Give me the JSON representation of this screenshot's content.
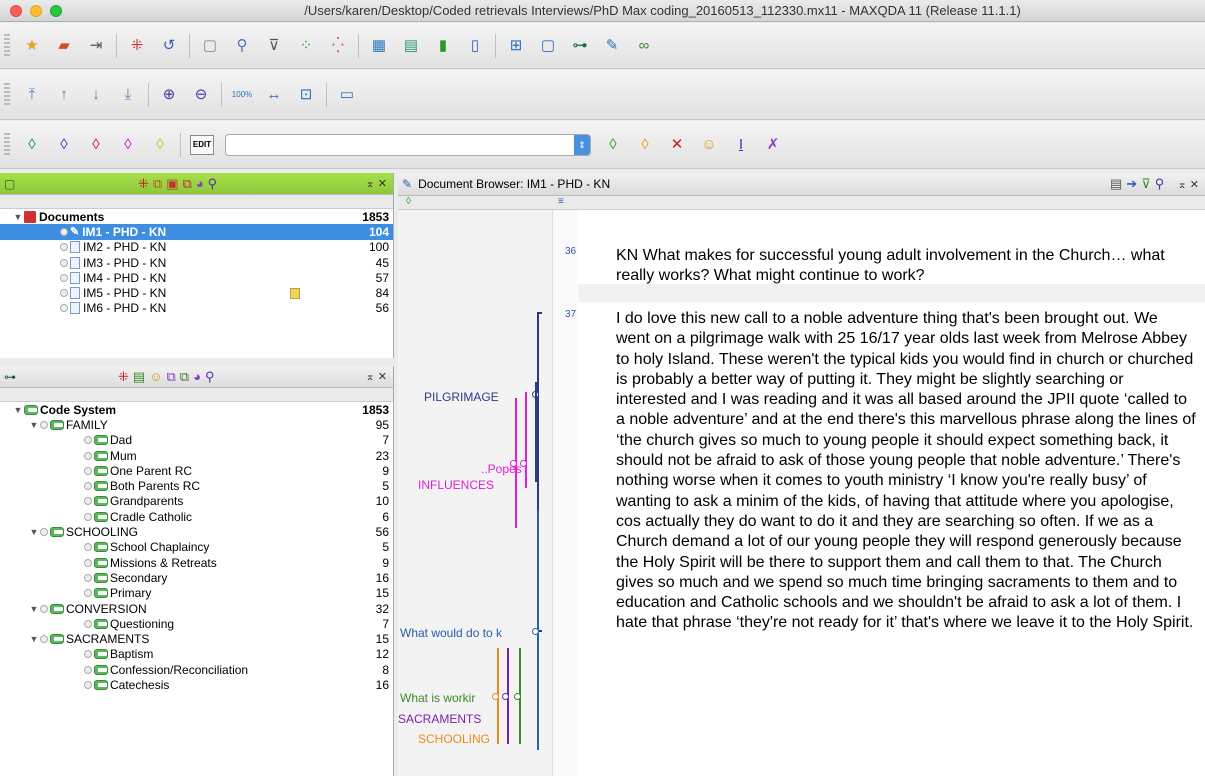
{
  "window": {
    "title": "/Users/karen/Desktop/Coded retrievals Interviews/PhD Max coding_20160513_112330.mx11 - MAXQDA 11 (Release 11.1.1)"
  },
  "toolbar3": {
    "edit_label": "EDIT"
  },
  "documents_panel": {
    "root": {
      "label": "Documents",
      "count": "1853"
    },
    "items": [
      {
        "label": "IM1 - PHD - KN",
        "count": "104"
      },
      {
        "label": "IM2 - PHD - KN",
        "count": "100"
      },
      {
        "label": "IM3 - PHD - KN",
        "count": "45"
      },
      {
        "label": "IM4 - PHD - KN",
        "count": "57"
      },
      {
        "label": "IM5 - PHD - KN",
        "count": "84"
      },
      {
        "label": "IM6 - PHD - KN",
        "count": "56"
      }
    ]
  },
  "code_panel": {
    "root": {
      "label": "Code System",
      "count": "1853"
    },
    "items": [
      {
        "label": "FAMILY",
        "count": "95"
      },
      {
        "label": "Dad",
        "count": "7"
      },
      {
        "label": "Mum",
        "count": "23"
      },
      {
        "label": "One Parent RC",
        "count": "9"
      },
      {
        "label": "Both Parents RC",
        "count": "5"
      },
      {
        "label": "Grandparents",
        "count": "10"
      },
      {
        "label": "Cradle Catholic",
        "count": "6"
      },
      {
        "label": "SCHOOLING",
        "count": "56"
      },
      {
        "label": "School Chaplaincy",
        "count": "5"
      },
      {
        "label": "Missions & Retreats",
        "count": "9"
      },
      {
        "label": "Secondary",
        "count": "16"
      },
      {
        "label": "Primary",
        "count": "15"
      },
      {
        "label": "CONVERSION",
        "count": "32"
      },
      {
        "label": "Questioning",
        "count": "7"
      },
      {
        "label": "SACRAMENTS",
        "count": "15"
      },
      {
        "label": "Baptism",
        "count": "12"
      },
      {
        "label": "Confession/Reconciliation",
        "count": "8"
      },
      {
        "label": "Catechesis",
        "count": "16"
      }
    ]
  },
  "doc_browser": {
    "title": "Document Browser: IM1 - PHD - KN",
    "codes": {
      "pilgrimage": "PILGRIMAGE",
      "popes": "..Popes",
      "influences": "INFLUENCES",
      "what_would": "What would do to k",
      "what_is": "What is workir",
      "sacraments": "SACRAMENTS",
      "schooling": "SCHOOLING"
    },
    "paragraphs": [
      {
        "num": "36",
        "text": "KN What makes for successful young adult involvement in the Church… what really works? What might continue to work?"
      },
      {
        "num": "37",
        "text": "I do love this new call to a noble adventure thing that's been brought out. We went on a pilgrimage walk with 25 16/17 year olds last week from Melrose Abbey to holy Island. These weren't the typical kids you would find in church or churched is probably a better way of putting it. They might be slightly searching or interested and I was reading and it was all based around the JPII quote ‘called to a noble adventure’ and at the end there's this marvellous phrase along the lines of ‘the church gives so much to young people it should expect something back, it should not be afraid to ask of those young people that noble adventure.’  There's nothing worse when it comes to youth ministry ‘I know you're really busy’ of wanting to ask a minim of the kids, of having that attitude where you apologise, cos actually they do want to do it and they are searching so often. If we as a Church demand a lot of our young people they will respond generously because the Holy Spirit will be there to support them and call them to that. The Church gives so much and we spend so much time bringing sacraments to them and to education and Catholic schools and we shouldn't be afraid to ask a lot of them. I hate that phrase ‘they're not ready for it’ that's where we leave it to the Holy Spirit."
      }
    ]
  },
  "colors": {
    "selection": "#3d8ee2",
    "pilgrimage": "#2b3a8a",
    "influences": "#e01fd6",
    "what_would": "#2a5ea8",
    "what_is": "#3a8a2a",
    "sacraments": "#7a1fa8",
    "schooling": "#f08a1a"
  }
}
